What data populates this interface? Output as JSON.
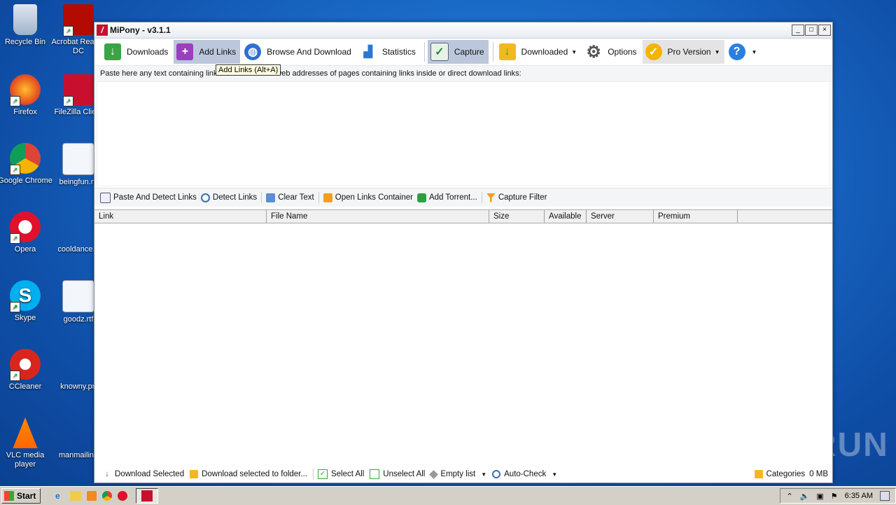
{
  "desktop": {
    "icons": [
      {
        "label": "Recycle Bin"
      },
      {
        "label": "Acrobat Reader DC"
      },
      {
        "label": "Firefox"
      },
      {
        "label": "FileZilla Client"
      },
      {
        "label": "Google Chrome"
      },
      {
        "label": "beingfun.rtf"
      },
      {
        "label": "Opera"
      },
      {
        "label": "cooldance.p"
      },
      {
        "label": "Skype"
      },
      {
        "label": "goodz.rtf"
      },
      {
        "label": "CCleaner"
      },
      {
        "label": "knowny.pn"
      },
      {
        "label": "VLC media player"
      },
      {
        "label": "manmailing"
      }
    ]
  },
  "window": {
    "title": "MiPony - v3.1.1",
    "buttons": {
      "minimize": "_",
      "maximize": "□",
      "close": "×"
    }
  },
  "toolbar": {
    "downloads": "Downloads",
    "add_links": "Add Links",
    "browse": "Browse And Download",
    "statistics": "Statistics",
    "capture": "Capture",
    "downloaded": "Downloaded",
    "options": "Options",
    "pro": "Pro Version",
    "help": "?"
  },
  "tooltip": "Add Links (Alt+A)",
  "hint": "Paste here any text containing links to download or web addresses of pages containing links inside or direct download links:",
  "subtoolbar": {
    "paste_detect": "Paste And Detect Links",
    "detect": "Detect Links",
    "clear": "Clear Text",
    "open_container": "Open Links Container",
    "add_torrent": "Add Torrent...",
    "capture_filter": "Capture Filter"
  },
  "table": {
    "columns": [
      "Link",
      "File Name",
      "Size",
      "Available",
      "Server",
      "Premium"
    ]
  },
  "bottombar": {
    "download_selected": "Download Selected",
    "download_folder": "Download selected to folder...",
    "select_all": "Select All",
    "unselect_all": "Unselect All",
    "empty_list": "Empty list",
    "auto_check": "Auto-Check",
    "categories": "Categories",
    "size": "0 MB"
  },
  "watermark": "ANY RUN",
  "taskbar": {
    "start": "Start",
    "clock": "6:35 AM"
  },
  "colors": {
    "toolbar_active": "#bcc7dc",
    "brand_red": "#c8102e"
  }
}
